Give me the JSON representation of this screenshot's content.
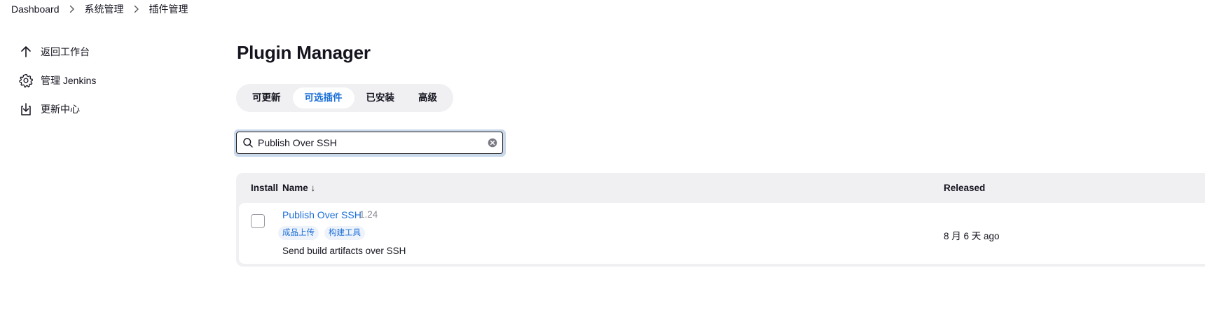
{
  "breadcrumb": {
    "items": [
      "Dashboard",
      "系统管理",
      "插件管理"
    ]
  },
  "sidebar": {
    "items": [
      {
        "label": "返回工作台",
        "icon": "arrow-up-icon"
      },
      {
        "label": "管理 Jenkins",
        "icon": "gear-icon"
      },
      {
        "label": "更新中心",
        "icon": "download-icon"
      }
    ]
  },
  "main": {
    "title": "Plugin Manager",
    "tabs": [
      {
        "label": "可更新",
        "active": false
      },
      {
        "label": "可选插件",
        "active": true
      },
      {
        "label": "已安装",
        "active": false
      },
      {
        "label": "高级",
        "active": false
      }
    ],
    "search": {
      "value": "Publish Over SSH",
      "placeholder": ""
    },
    "table": {
      "headers": {
        "install": "Install",
        "name": "Name ↓",
        "released": "Released"
      },
      "rows": [
        {
          "name": "Publish Over SSH",
          "version": "1.24",
          "tags": [
            "成品上传",
            "构建工具"
          ],
          "description": "Send build artifacts over SSH",
          "released": "8 月 6 天 ago",
          "checked": false
        }
      ]
    }
  },
  "colors": {
    "accent": "#1a6ed8",
    "tab_bg": "#f0f0f3",
    "search_focus_ring": "#c9d8ea"
  }
}
